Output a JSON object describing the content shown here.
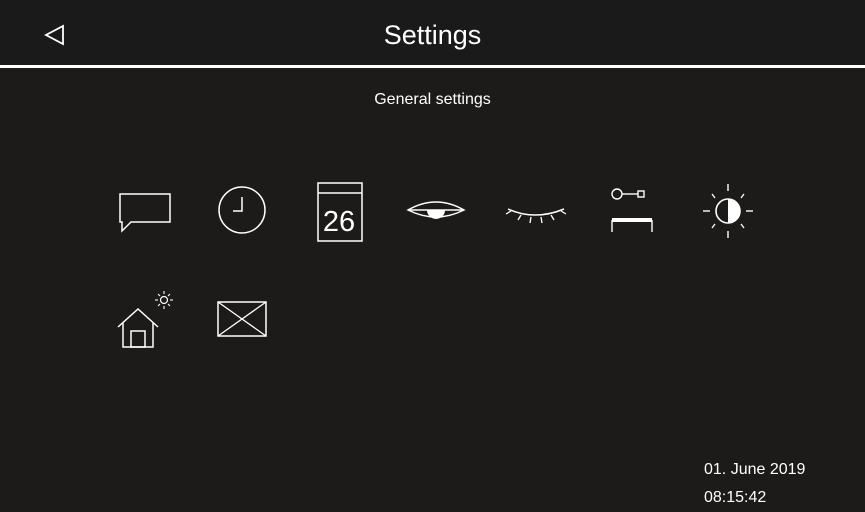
{
  "header": {
    "title": "Settings",
    "back_icon": "back-triangle-icon"
  },
  "section": {
    "title": "General settings"
  },
  "settings_items": [
    {
      "icon": "speech-bubble-icon"
    },
    {
      "icon": "clock-icon"
    },
    {
      "icon": "calendar-icon",
      "day": "26"
    },
    {
      "icon": "eye-open-icon"
    },
    {
      "icon": "eye-closed-icon"
    },
    {
      "icon": "key-door-icon"
    },
    {
      "icon": "brightness-icon"
    },
    {
      "icon": "house-sun-icon"
    },
    {
      "icon": "envelope-icon"
    }
  ],
  "status": {
    "date": "01. June 2019",
    "time": "08:15:42"
  },
  "colors": {
    "background": "#1c1b1a",
    "foreground": "#ffffff"
  }
}
